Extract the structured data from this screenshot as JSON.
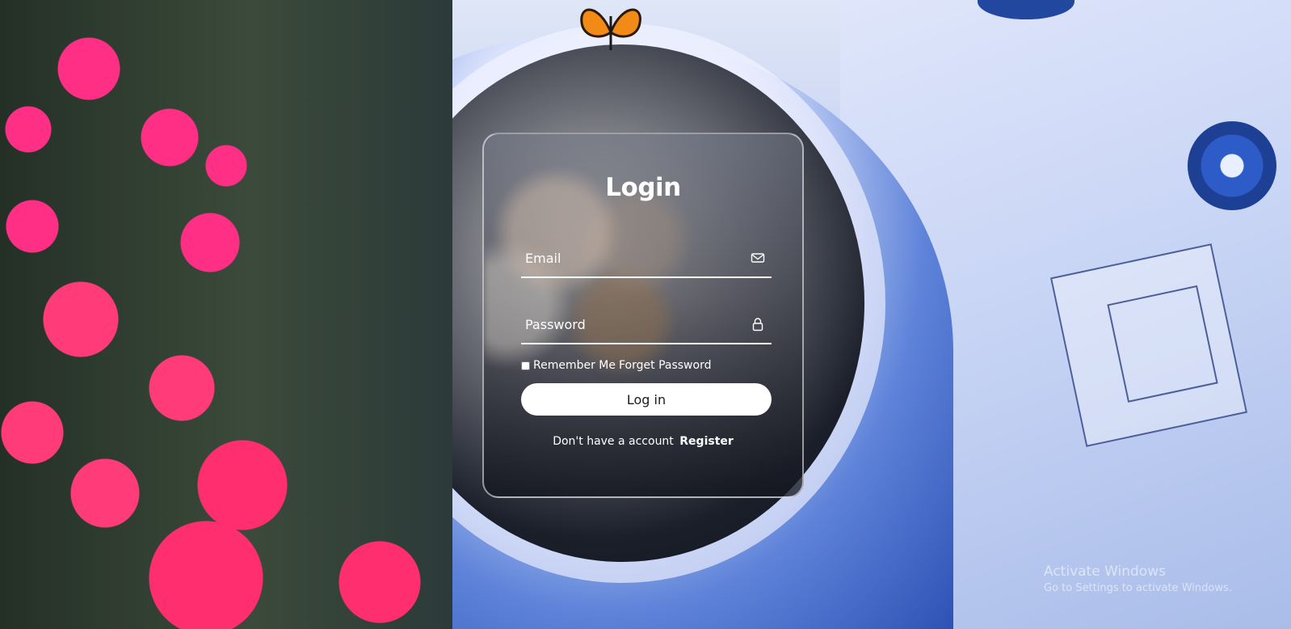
{
  "login": {
    "title": "Login",
    "email_placeholder": "Email",
    "password_placeholder": "Password",
    "remember_label": "Remember Me",
    "forget_label": "Forget Password",
    "login_button": "Log in",
    "register_prompt": "Don't have a account",
    "register_link": "Register"
  },
  "icons": {
    "email": "envelope-icon",
    "password": "lock-icon"
  },
  "watermark": {
    "title": "Activate Windows",
    "subtitle": "Go to Settings to activate Windows."
  }
}
